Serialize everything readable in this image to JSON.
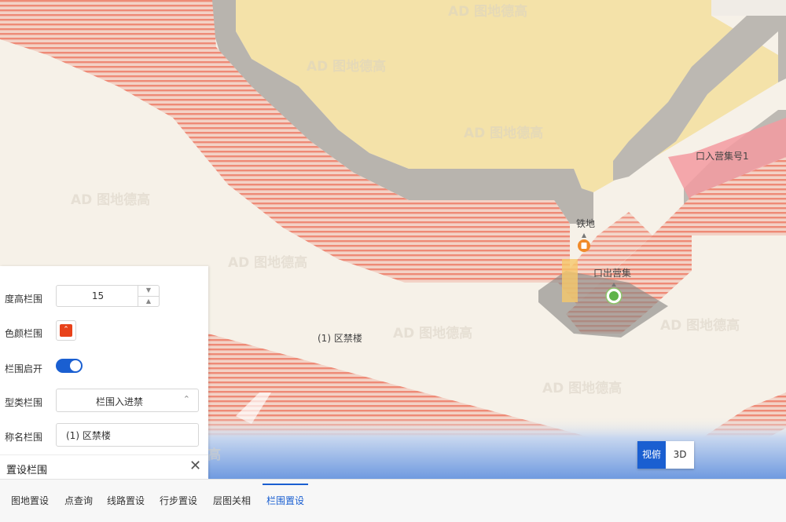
{
  "colors": {
    "accent": "#1a5fd1",
    "fence_color": "#e8421a"
  },
  "map": {
    "area_label": "(1) 区禁楼",
    "exit_label": "口出营集",
    "station_label": "铁地",
    "gate_label": "口入营集号1",
    "watermark": "AD 图地德高"
  },
  "view_toggle": {
    "mode_2d": "视俯",
    "mode_3d": "3D"
  },
  "panel": {
    "title": "置设栏围",
    "close_icon": "close-icon",
    "name_label": "称名栏围",
    "name_value": "(1) 区禁楼",
    "type_label": "型类栏围",
    "type_value": "栏围入进禁",
    "enabled_label": "栏围启开",
    "enabled": true,
    "color_label": "色颜栏围",
    "color_icon": "chevron-down-icon",
    "height_label": "度高栏围",
    "height_value": "15"
  },
  "tabs": [
    {
      "label": "栏围置设",
      "active": true
    },
    {
      "label": "层图关相",
      "active": false
    },
    {
      "label": "行步置设",
      "active": false
    },
    {
      "label": "线路置设",
      "active": false
    },
    {
      "label": "点查询",
      "active": false
    },
    {
      "label": "图地置设",
      "active": false
    }
  ]
}
